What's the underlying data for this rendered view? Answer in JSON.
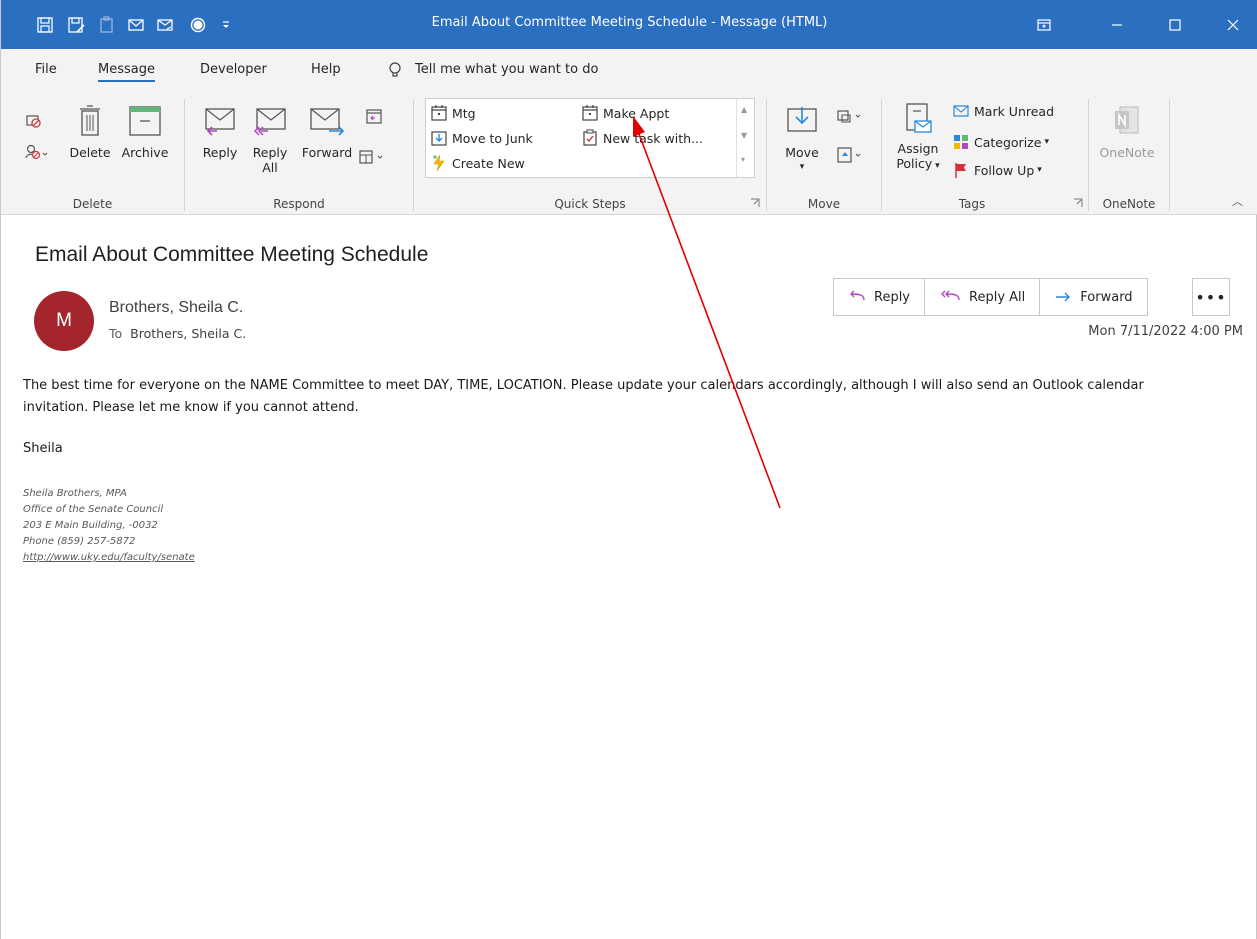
{
  "window": {
    "title": "Email About Committee Meeting Schedule  -  Message (HTML)",
    "qat_icons": [
      "save-icon",
      "save-as-icon",
      "paste-icon",
      "mail-envelope-icon",
      "mail-reply-icon",
      "record-circle-icon",
      "customize-qat-icon"
    ],
    "controls": [
      "restore-ribbon-icon",
      "minimize-icon",
      "maximize-icon",
      "close-icon"
    ]
  },
  "tabs": {
    "file": "File",
    "message": "Message",
    "developer": "Developer",
    "help": "Help",
    "tell_me": "Tell me what you want to do"
  },
  "ribbon": {
    "delete_group": {
      "label": "Delete",
      "delete": "Delete",
      "archive": "Archive"
    },
    "respond_group": {
      "label": "Respond",
      "reply": "Reply",
      "reply_all_line1": "Reply",
      "reply_all_line2": "All",
      "forward": "Forward"
    },
    "quick_steps": {
      "label": "Quick Steps",
      "items": [
        "Mtg",
        "Make Appt",
        "Move to Junk",
        "New task with...",
        "Create New"
      ]
    },
    "move_group": {
      "label": "Move",
      "move": "Move"
    },
    "tags_group": {
      "label": "Tags",
      "assign_line1": "Assign",
      "assign_line2": "Policy",
      "mark_unread": "Mark Unread",
      "categorize": "Categorize",
      "follow_up": "Follow Up"
    },
    "onenote_group": {
      "label": "OneNote",
      "onenote": "OneNote"
    }
  },
  "message": {
    "subject": "Email About Committee Meeting Schedule",
    "avatar_initial": "M",
    "sender": "Brothers, Sheila C.",
    "to_label": "To",
    "to": "Brothers, Sheila C.",
    "actions": {
      "reply": "Reply",
      "reply_all": "Reply All",
      "forward": "Forward",
      "more": "•••"
    },
    "date": "Mon 7/11/2022 4:00 PM",
    "body_line1": "The best time for everyone on the NAME Committee  to meet DAY, TIME, LOCATION. Please update your calendars accordingly, although I will also send an Outlook calendar",
    "body_line2": "invitation. Please let me know if you cannot attend.",
    "signoff": "Sheila",
    "signature": [
      "Sheila Brothers, MPA",
      "Office of the Senate Council",
      "203 E Main Building, -0032",
      "Phone (859) 257-5872",
      "http://www.uky.edu/faculty/senate"
    ]
  },
  "colors": {
    "titlebar": "#2b6fc0",
    "avatar": "#a4262c",
    "annotation_arrow": "#e00000"
  }
}
